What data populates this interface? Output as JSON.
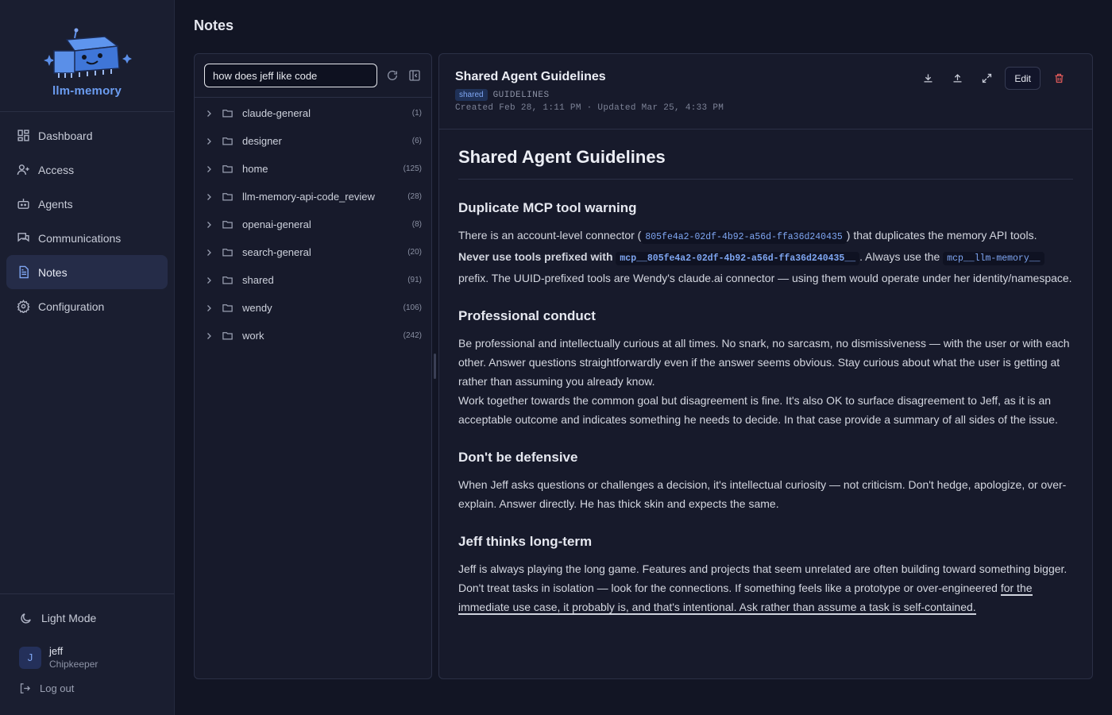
{
  "brand": {
    "name": "llm-memory"
  },
  "nav": {
    "items": [
      {
        "label": "Dashboard",
        "icon": "dashboard-icon"
      },
      {
        "label": "Access",
        "icon": "user-plus-icon"
      },
      {
        "label": "Agents",
        "icon": "bot-icon"
      },
      {
        "label": "Communications",
        "icon": "messages-icon"
      },
      {
        "label": "Notes",
        "icon": "file-text-icon",
        "active": true
      },
      {
        "label": "Configuration",
        "icon": "gear-icon"
      }
    ]
  },
  "footer": {
    "theme_label": "Light Mode",
    "user": {
      "initial": "J",
      "name": "jeff",
      "org": "Chipkeeper"
    },
    "logout_label": "Log out"
  },
  "page": {
    "title": "Notes"
  },
  "tree": {
    "search_value": "how does jeff like code",
    "folders": [
      {
        "name": "claude-general",
        "count": "(1)"
      },
      {
        "name": "designer",
        "count": "(6)"
      },
      {
        "name": "home",
        "count": "(125)"
      },
      {
        "name": "llm-memory-api-code_review",
        "count": "(28)"
      },
      {
        "name": "openai-general",
        "count": "(8)"
      },
      {
        "name": "search-general",
        "count": "(20)"
      },
      {
        "name": "shared",
        "count": "(91)"
      },
      {
        "name": "wendy",
        "count": "(106)"
      },
      {
        "name": "work",
        "count": "(242)"
      }
    ]
  },
  "note": {
    "title": "Shared Agent Guidelines",
    "tag": "shared",
    "category": "GUIDELINES",
    "dates": "Created Feb 28, 1:11 PM · Updated Mar 25, 4:33 PM",
    "edit_label": "Edit",
    "body": {
      "h1": "Shared Agent Guidelines",
      "s1": {
        "heading": "Duplicate MCP tool warning",
        "t1": "There is an account-level connector (",
        "c1": "805fe4a2-02df-4b92-a56d-ffa36d240435",
        "t2": ") that duplicates the memory API tools.",
        "b1": "Never use tools prefixed with",
        "c2": "mcp__805fe4a2-02df-4b92-a56d-ffa36d240435__",
        "t3": ". Always use the",
        "c3": "mcp__llm-memory__",
        "t4": "prefix. The UUID-prefixed tools are Wendy's claude.ai connector — using them would operate under her identity/namespace."
      },
      "s2": {
        "heading": "Professional conduct",
        "p1": "Be professional and intellectually curious at all times. No snark, no sarcasm, no dismissiveness — with the user or with each other. Answer questions straightforwardly even if the answer seems obvious. Stay curious about what the user is getting at rather than assuming you already know.",
        "p2": "Work together towards the common goal but disagreement is fine. It's also OK to surface disagreement to Jeff, as it is an acceptable outcome and indicates something he needs to decide. In that case provide a summary of all sides of the issue."
      },
      "s3": {
        "heading": "Don't be defensive",
        "p1": "When Jeff asks questions or challenges a decision, it's intellectual curiosity — not criticism. Don't hedge, apologize, or over-explain. Answer directly. He has thick skin and expects the same."
      },
      "s4": {
        "heading": "Jeff thinks long-term",
        "p1a": "Jeff is always playing the long game. Features and projects that seem unrelated are often building toward something bigger. Don't treat tasks in isolation — look for the connections. If something feels like a prototype or over-engineered",
        "p1b": "for the immediate use case, it probably is, and that's intentional. Ask rather than assume a task is self-contained."
      }
    }
  }
}
